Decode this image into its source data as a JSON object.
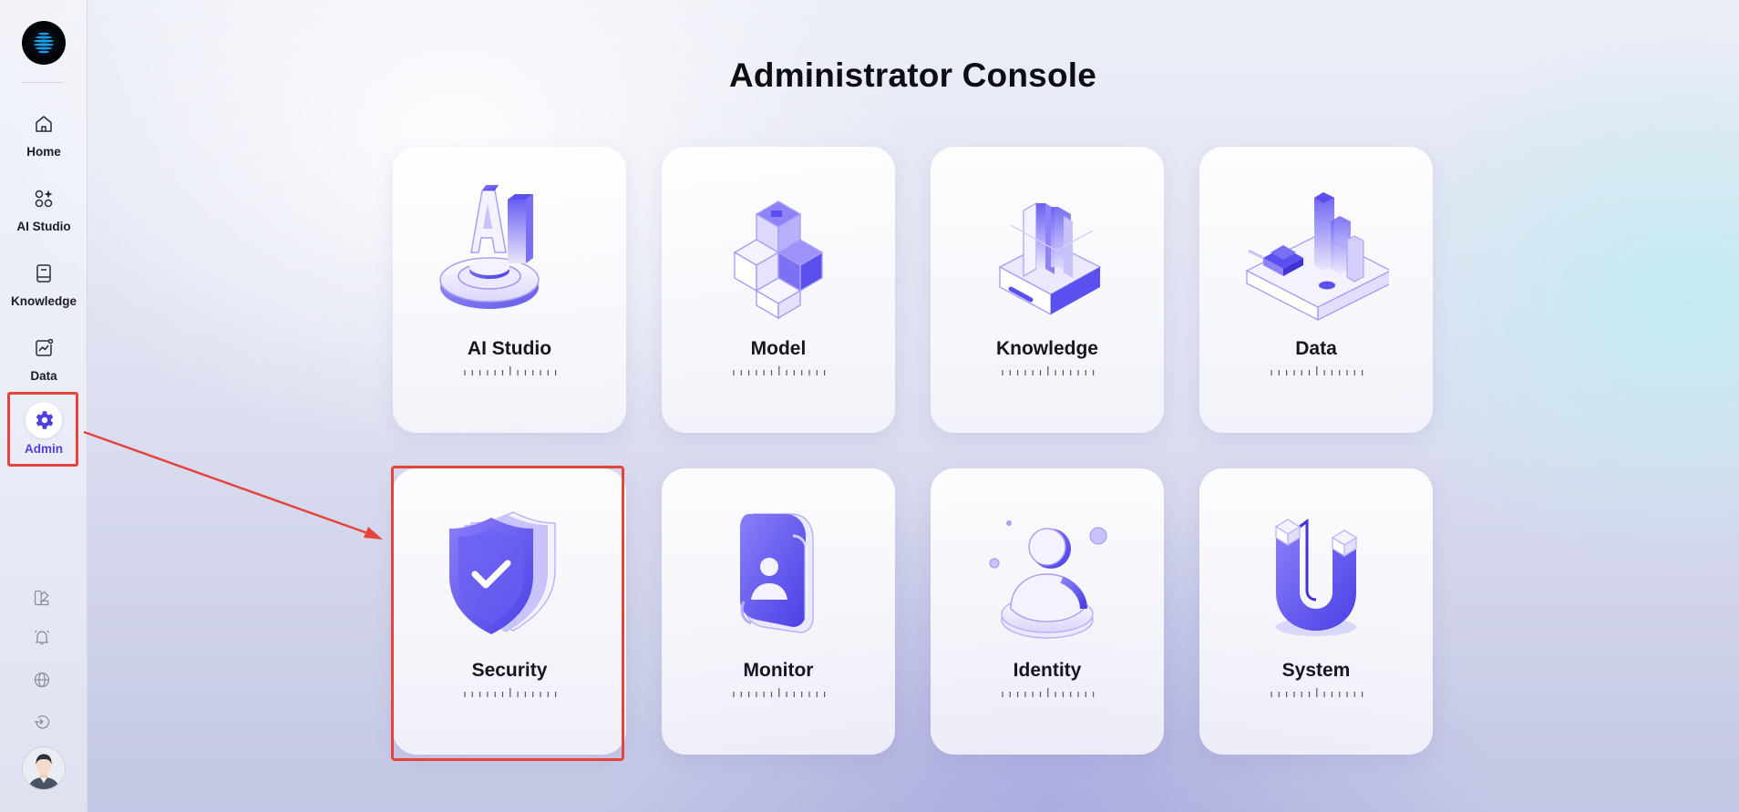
{
  "page": {
    "title": "Administrator Console"
  },
  "sidebar": {
    "items": [
      {
        "label": "Home",
        "icon": "home-icon"
      },
      {
        "label": "AI Studio",
        "icon": "apps-sparkle-icon"
      },
      {
        "label": "Knowledge",
        "icon": "book-icon"
      },
      {
        "label": "Data",
        "icon": "chart-icon"
      },
      {
        "label": "Admin",
        "icon": "gear-icon",
        "active": true
      }
    ],
    "tools": [
      "palette-icon",
      "bell-icon",
      "globe-icon",
      "logout-icon"
    ]
  },
  "cards": [
    {
      "label": "AI Studio",
      "icon": "ai-studio-illustration"
    },
    {
      "label": "Model",
      "icon": "model-cubes-illustration"
    },
    {
      "label": "Knowledge",
      "icon": "knowledge-books-illustration"
    },
    {
      "label": "Data",
      "icon": "data-bars-illustration"
    },
    {
      "label": "Security",
      "icon": "shield-check-illustration"
    },
    {
      "label": "Monitor",
      "icon": "monitor-badge-illustration"
    },
    {
      "label": "Identity",
      "icon": "identity-person-illustration"
    },
    {
      "label": "System",
      "icon": "system-magnet-illustration"
    }
  ],
  "colors": {
    "accent": "#5b4ff0",
    "highlight": "#e5443d",
    "text": "#16161f"
  }
}
